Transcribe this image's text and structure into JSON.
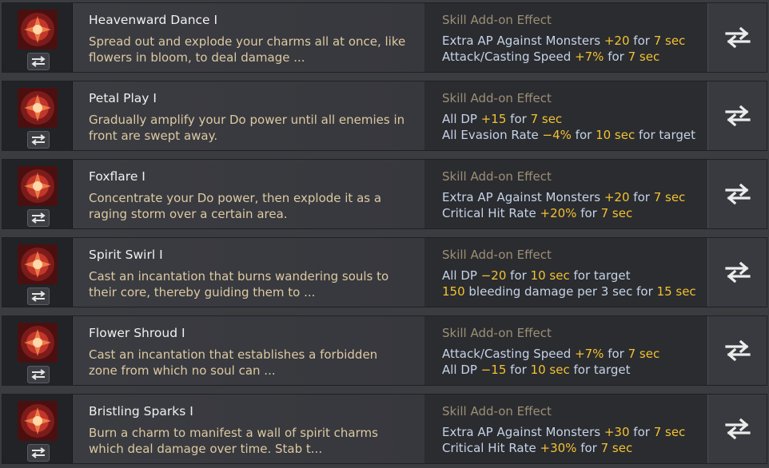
{
  "effect_header": "Skill Add-on Effect",
  "colors": {
    "value_highlight": "#f2c230",
    "effect_text": "#c5d3e6",
    "description": "#dcc9a2"
  },
  "skills": [
    {
      "name": "Heavenward Dance I",
      "description": "Spread out and explode your charms all at once, like flowers in bloom, to deal damage ...",
      "icon": "heavenward-dance-icon",
      "effects": [
        [
          {
            "t": "Extra AP Against Monsters "
          },
          {
            "t": "+20",
            "h": true
          },
          {
            "t": " for "
          },
          {
            "t": "7 sec",
            "h": true
          }
        ],
        [
          {
            "t": "Attack/Casting Speed "
          },
          {
            "t": "+7%",
            "h": true
          },
          {
            "t": " for "
          },
          {
            "t": "7 sec",
            "h": true
          }
        ]
      ]
    },
    {
      "name": "Petal Play I",
      "description": "Gradually amplify your Do power until all enemies in front are swept away.",
      "icon": "petal-play-icon",
      "effects": [
        [
          {
            "t": "All DP "
          },
          {
            "t": "+15",
            "h": true
          },
          {
            "t": " for "
          },
          {
            "t": "7 sec",
            "h": true
          }
        ],
        [
          {
            "t": "All Evasion Rate "
          },
          {
            "t": "−4%",
            "h": true
          },
          {
            "t": " for "
          },
          {
            "t": "10 sec",
            "h": true
          },
          {
            "t": " for target"
          }
        ]
      ]
    },
    {
      "name": "Foxflare I",
      "description": "Concentrate your Do power, then explode it as a raging storm over a certain area.",
      "icon": "foxflare-icon",
      "effects": [
        [
          {
            "t": "Extra AP Against Monsters "
          },
          {
            "t": "+20",
            "h": true
          },
          {
            "t": " for "
          },
          {
            "t": "7 sec",
            "h": true
          }
        ],
        [
          {
            "t": "Critical Hit Rate "
          },
          {
            "t": "+20%",
            "h": true
          },
          {
            "t": " for "
          },
          {
            "t": "7 sec",
            "h": true
          }
        ]
      ]
    },
    {
      "name": "Spirit Swirl I",
      "description": "Cast an incantation that burns wandering souls to their core, thereby guiding them to ...",
      "icon": "spirit-swirl-icon",
      "effects": [
        [
          {
            "t": "All DP "
          },
          {
            "t": "−20",
            "h": true
          },
          {
            "t": " for "
          },
          {
            "t": "10 sec",
            "h": true
          },
          {
            "t": " for target"
          }
        ],
        [
          {
            "t": "150",
            "h": true
          },
          {
            "t": " bleeding damage per 3 sec for "
          },
          {
            "t": "15 sec",
            "h": true
          }
        ]
      ]
    },
    {
      "name": "Flower Shroud I",
      "description": "Cast an incantation that establishes a forbidden zone from which no soul can ...",
      "icon": "flower-shroud-icon",
      "effects": [
        [
          {
            "t": "Attack/Casting Speed "
          },
          {
            "t": "+7%",
            "h": true
          },
          {
            "t": " for "
          },
          {
            "t": "7 sec",
            "h": true
          }
        ],
        [
          {
            "t": "All DP "
          },
          {
            "t": "−15",
            "h": true
          },
          {
            "t": " for "
          },
          {
            "t": "10 sec",
            "h": true
          },
          {
            "t": " for target"
          }
        ]
      ]
    },
    {
      "name": "Bristling Sparks I",
      "description": "Burn a charm to manifest a wall of spirit charms which deal damage over time. Stab t...",
      "icon": "bristling-sparks-icon",
      "effects": [
        [
          {
            "t": "Extra AP Against Monsters "
          },
          {
            "t": "+30",
            "h": true
          },
          {
            "t": " for "
          },
          {
            "t": "7 sec",
            "h": true
          }
        ],
        [
          {
            "t": "Critical Hit Rate "
          },
          {
            "t": "+30%",
            "h": true
          },
          {
            "t": " for "
          },
          {
            "t": "7 sec",
            "h": true
          }
        ]
      ]
    }
  ]
}
